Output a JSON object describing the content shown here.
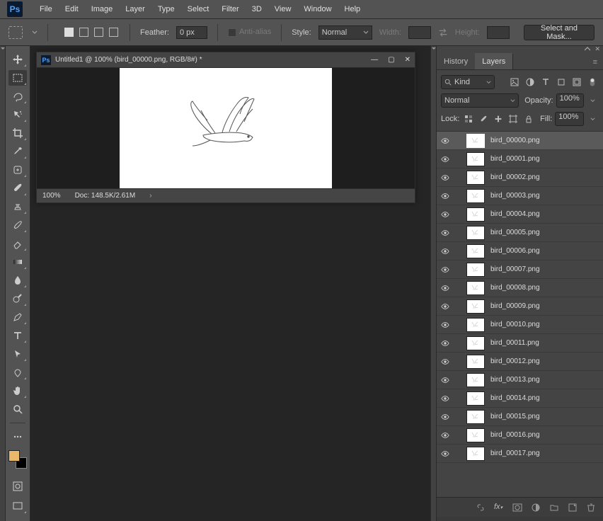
{
  "app": {
    "logo": "Ps"
  },
  "menu": [
    "File",
    "Edit",
    "Image",
    "Layer",
    "Type",
    "Select",
    "Filter",
    "3D",
    "View",
    "Window",
    "Help"
  ],
  "options": {
    "feather_label": "Feather:",
    "feather_value": "0 px",
    "anti_alias": "Anti-alias",
    "style_label": "Style:",
    "style_value": "Normal",
    "width_label": "Width:",
    "height_label": "Height:",
    "select_mask": "Select and Mask..."
  },
  "document": {
    "title": "Untitled1 @ 100% (bird_00000.png, RGB/8#) *",
    "zoom": "100%",
    "doc_info": "Doc: 148.5K/2.61M"
  },
  "panels": {
    "tab_history": "History",
    "tab_layers": "Layers",
    "filter_kind": "Kind",
    "blend_mode": "Normal",
    "opacity_label": "Opacity:",
    "opacity_value": "100%",
    "lock_label": "Lock:",
    "fill_label": "Fill:",
    "fill_value": "100%"
  },
  "layers": [
    {
      "name": "bird_00000.png",
      "selected": true
    },
    {
      "name": "bird_00001.png",
      "selected": false
    },
    {
      "name": "bird_00002.png",
      "selected": false
    },
    {
      "name": "bird_00003.png",
      "selected": false
    },
    {
      "name": "bird_00004.png",
      "selected": false
    },
    {
      "name": "bird_00005.png",
      "selected": false
    },
    {
      "name": "bird_00006.png",
      "selected": false
    },
    {
      "name": "bird_00007.png",
      "selected": false
    },
    {
      "name": "bird_00008.png",
      "selected": false
    },
    {
      "name": "bird_00009.png",
      "selected": false
    },
    {
      "name": "bird_00010.png",
      "selected": false
    },
    {
      "name": "bird_00011.png",
      "selected": false
    },
    {
      "name": "bird_00012.png",
      "selected": false
    },
    {
      "name": "bird_00013.png",
      "selected": false
    },
    {
      "name": "bird_00014.png",
      "selected": false
    },
    {
      "name": "bird_00015.png",
      "selected": false
    },
    {
      "name": "bird_00016.png",
      "selected": false
    },
    {
      "name": "bird_00017.png",
      "selected": false
    }
  ],
  "tools": [
    "move-tool",
    "marquee-tool",
    "lasso-tool",
    "quick-select-tool",
    "crop-tool",
    "eyedropper-tool",
    "healing-brush-tool",
    "brush-tool",
    "clone-stamp-tool",
    "history-brush-tool",
    "eraser-tool",
    "gradient-tool",
    "blur-tool",
    "dodge-tool",
    "pen-tool",
    "type-tool",
    "path-select-tool",
    "shape-tool",
    "hand-tool",
    "zoom-tool"
  ]
}
